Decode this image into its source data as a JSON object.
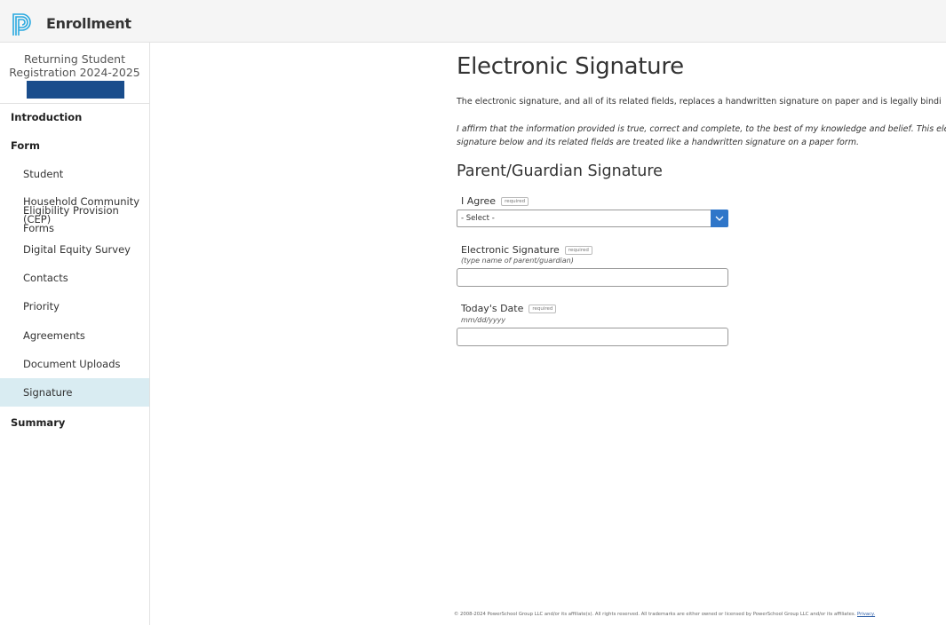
{
  "header": {
    "app_title": "Enrollment",
    "logo_icon": "powerschool-logo-icon",
    "brand_color": "#29a9e0"
  },
  "sidebar": {
    "registration_title_line1": "Returning Student",
    "registration_title_line2": "Registration 2024-2025",
    "bar_color": "#1a4d8c",
    "sections": {
      "introduction": "Introduction",
      "form": "Form",
      "summary": "Summary"
    },
    "items": [
      {
        "label": "Student"
      },
      {
        "label_line1": "Household Community",
        "label_line2": "Eligibility Provision (CEP)",
        "label_line3": "Forms"
      },
      {
        "label": "Digital Equity Survey"
      },
      {
        "label": "Contacts"
      },
      {
        "label": "Priority"
      },
      {
        "label": "Agreements"
      },
      {
        "label": "Document Uploads"
      },
      {
        "label": "Signature",
        "active": true
      }
    ],
    "active_color": "#d9ecf2"
  },
  "main": {
    "page_title": "Electronic Signature",
    "intro_text": "The electronic signature, and all of its related fields, replaces a handwritten signature on paper and is legally bindi",
    "affirm_line1": "I affirm that the information provided is true, correct and complete, to the best of my knowledge and belief. This electron",
    "affirm_line2": "signature below and its related fields are treated like a handwritten signature on a paper form.",
    "section_title": "Parent/Guardian Signature",
    "fields": {
      "agree": {
        "label": "I Agree",
        "required_badge": "required",
        "selected_value": "- Select -"
      },
      "signature": {
        "label": "Electronic Signature",
        "required_badge": "required",
        "hint": "(type name of parent/guardian)",
        "value": ""
      },
      "date": {
        "label": "Today's Date",
        "required_badge": "required",
        "hint": "mm/dd/yyyy",
        "value": ""
      }
    },
    "select_button_color": "#2f76c9"
  },
  "footer": {
    "copyright": "© 2008-2024 PowerSchool Group LLC and/or its affiliate(s). All rights reserved. All trademarks are either owned or licensed by PowerSchool Group LLC and/or its affiliates.",
    "privacy_link": "Privacy."
  }
}
